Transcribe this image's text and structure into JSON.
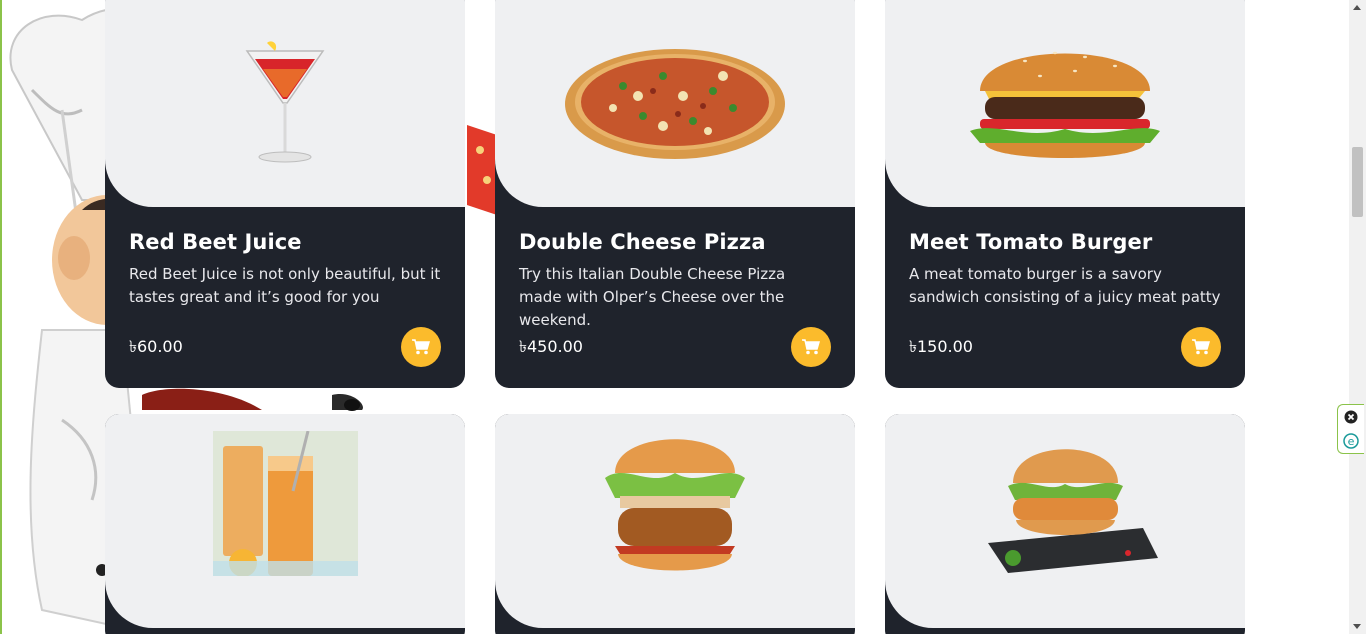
{
  "menu": {
    "items": [
      {
        "name": "Red Beet Juice",
        "description": "Red Beet Juice is not only beautiful, but it tastes great and it’s good for you",
        "price": "৳60.00",
        "image_icon": "cocktail-glass-image"
      },
      {
        "name": "Double Cheese Pizza",
        "description": "Try this Italian Double Cheese Pizza made with Olper’s Cheese over the weekend.",
        "price": "৳450.00",
        "image_icon": "pizza-image"
      },
      {
        "name": "Meet Tomato Burger",
        "description": "A meat tomato burger is a savory sandwich consisting of a juicy meat patty",
        "price": "৳150.00",
        "image_icon": "burger-image"
      },
      {
        "image_icon": "orange-juice-image"
      },
      {
        "image_icon": "chicken-burger-image"
      },
      {
        "image_icon": "veggie-burger-image"
      }
    ]
  },
  "colors": {
    "card_dark": "#1f232c",
    "image_bg": "#eff0f2",
    "cart_button": "#fbbb2c",
    "page_border": "#8bc34a"
  }
}
